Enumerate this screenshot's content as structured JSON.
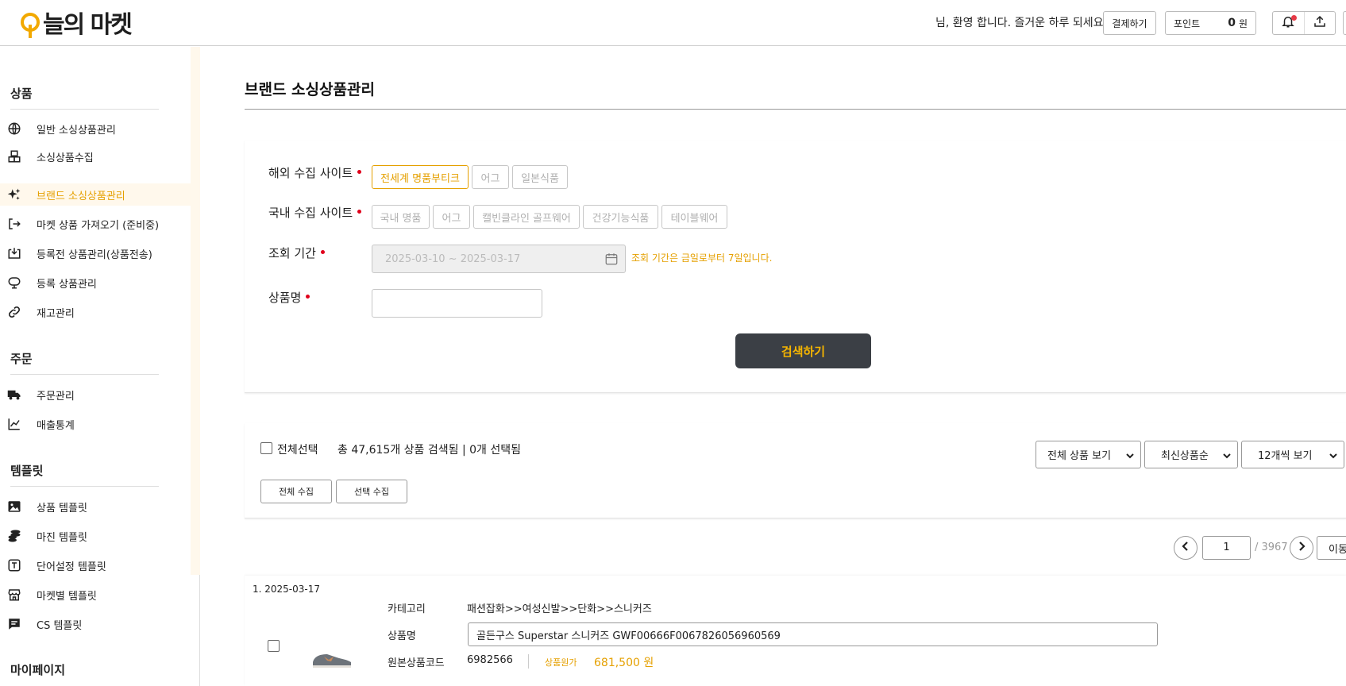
{
  "header": {
    "logo_text": "늘의 마켓",
    "welcome": "님, 환영 합니다. 즐거운 하루 되세요.",
    "pay_label": "결제하기",
    "point_label": "포인트",
    "point_value": "0",
    "point_unit": "원",
    "icons": [
      "bell-icon",
      "upload-icon"
    ]
  },
  "sidebar": {
    "sections": [
      {
        "title": "상품",
        "items": [
          {
            "label": "일반 소싱상품관리",
            "icon": "globe-icon"
          },
          {
            "label": "소싱상품수집",
            "icon": "boxes-icon"
          },
          {
            "label": "브랜드 소싱상품관리",
            "icon": "sparkle-icon",
            "active": true
          },
          {
            "label": "마켓 상품 가져오기 (준비중)",
            "icon": "import-icon"
          },
          {
            "label": "등록전 상품관리(상품전송)",
            "icon": "tray-download-icon"
          },
          {
            "label": "등록 상품관리",
            "icon": "monitor-icon"
          },
          {
            "label": "재고관리",
            "icon": "link-icon"
          }
        ]
      },
      {
        "title": "주문",
        "items": [
          {
            "label": "주문관리",
            "icon": "truck-icon"
          },
          {
            "label": "매출통계",
            "icon": "chart-line-icon"
          }
        ]
      },
      {
        "title": "템플릿",
        "items": [
          {
            "label": "상품 템플릿",
            "icon": "image-icon"
          },
          {
            "label": "마진 템플릿",
            "icon": "coins-icon"
          },
          {
            "label": "단어설정 템플릿",
            "icon": "text-box-icon"
          },
          {
            "label": "마켓별 템플릿",
            "icon": "store-icon"
          },
          {
            "label": "CS 템플릿",
            "icon": "chat-icon"
          }
        ]
      },
      {
        "title": "마이페이지",
        "items": []
      }
    ]
  },
  "main": {
    "title": "브랜드 소싱상품관리",
    "filters": {
      "overseas_label": "해외 수집 사이트",
      "overseas_sites": [
        {
          "label": "전세계 명품부티크",
          "selected": true
        },
        {
          "label": "어그",
          "selected": false
        },
        {
          "label": "일본식품",
          "selected": false
        }
      ],
      "domestic_label": "국내 수집 사이트",
      "domestic_sites": [
        {
          "label": "국내 명품",
          "selected": false
        },
        {
          "label": "어그",
          "selected": false
        },
        {
          "label": "캘빈클라인 골프웨어",
          "selected": false
        },
        {
          "label": "건강기능식품",
          "selected": false
        },
        {
          "label": "테이블웨어",
          "selected": false
        }
      ],
      "period_label": "조회 기간",
      "period_value": "2025-03-10 ~ 2025-03-17",
      "period_hint": "조회 기간은 금일로부터 7일입니다.",
      "name_label": "상품명",
      "name_value": "",
      "search_button": "검색하기"
    },
    "results": {
      "select_all_label": "전체선택",
      "count_text": "총 47,615개 상품 검색됨 | 0개 선택됨",
      "view_filter": "전체 상품 보기",
      "sort": "최신상품순",
      "per_page": "12개씩 보기",
      "collect_all": "전체 수집",
      "collect_selected": "선택 수집"
    },
    "pager": {
      "current": "1",
      "total": "/ 3967",
      "move_label": "이동"
    },
    "items": [
      {
        "no_date": "1. 2025-03-17",
        "category_label": "카테고리",
        "category": "패션잡화>>여성신발>>단화>>스니커즈",
        "name_label": "상품명",
        "name": "골든구스 Superstar 스니커즈 GWF00666F0067826056960569",
        "code_label": "원본상품코드",
        "code": "6982566",
        "price_label": "상품원가",
        "price": "681,500 원"
      }
    ]
  },
  "colors": {
    "accent": "#e5a000",
    "button_dark": "#3b3f45",
    "button_text": "#f4b400",
    "required": "#e0001b"
  }
}
